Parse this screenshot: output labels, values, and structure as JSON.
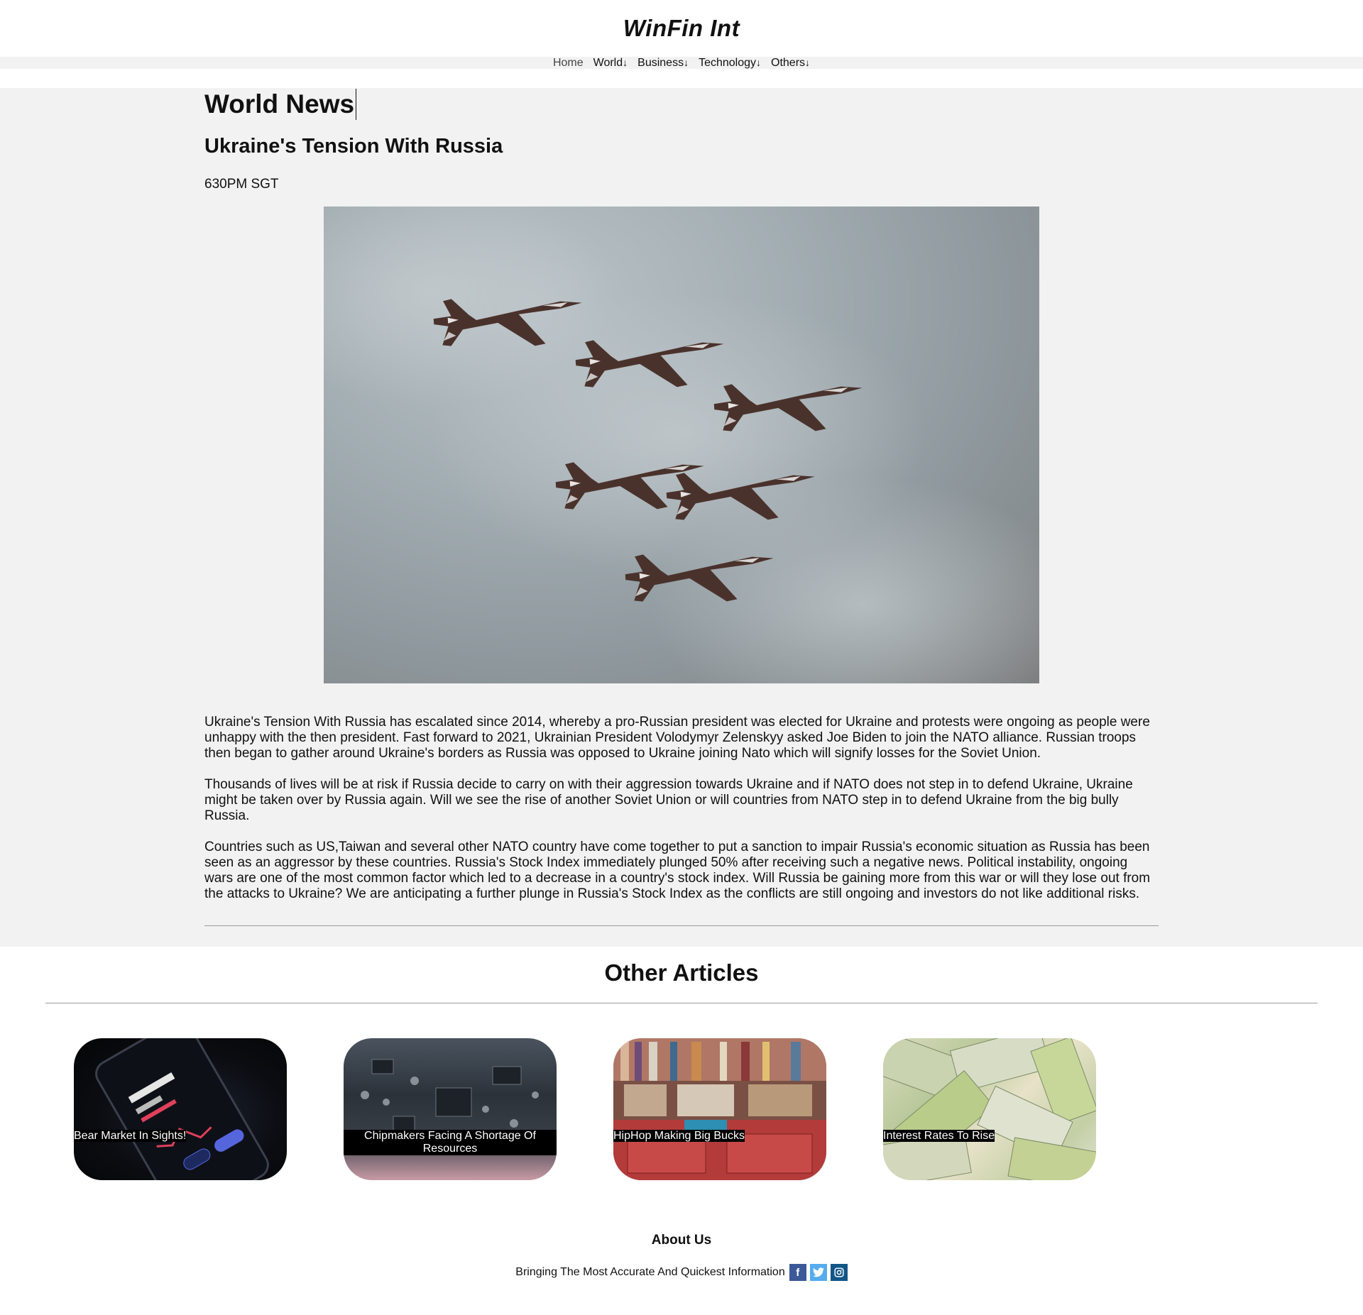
{
  "site": {
    "brand": "WinFin Int"
  },
  "nav": {
    "items": [
      {
        "label": "Home",
        "arrow": ""
      },
      {
        "label": "World",
        "arrow": "↓"
      },
      {
        "label": "Business",
        "arrow": "↓"
      },
      {
        "label": "Technology",
        "arrow": "↓"
      },
      {
        "label": "Others",
        "arrow": "↓"
      }
    ]
  },
  "main": {
    "page_title": "World News",
    "article_title": "Ukraine's Tension With Russia",
    "timestamp": "630PM SGT",
    "hero_image": "fighter-jets-formation-image",
    "paragraphs": [
      "Ukraine's Tension With Russia has escalated since 2014, whereby a pro-Russian president was elected for Ukraine and protests were ongoing as people were unhappy with the then president. Fast forward to 2021, Ukrainian President Volodymyr Zelenskyy asked Joe Biden to join the NATO alliance. Russian troops then began to gather around Ukraine's borders as Russia was opposed to Ukraine joining Nato which will signify losses for the Soviet Union.",
      "Thousands of lives will be at risk if Russia decide to carry on with their aggression towards Ukraine and if NATO does not step in to defend Ukraine, Ukraine might be taken over by Russia again. Will we see the rise of another Soviet Union or will countries from NATO step in to defend Ukraine from the big bully Russia.",
      "Countries such as US,Taiwan and several other NATO country have come together to put a sanction to impair Russia's economic situation as Russia has been seen as an aggressor by these countries. Russia's Stock Index immediately plunged 50% after receiving such a negative news. Political instability, ongoing wars are one of the most common factor which led to a decrease in a country's stock index. Will Russia be gaining more from this war or will they lose out from the attacks to Ukraine? We are anticipating a further plunge in Russia's Stock Index as the conflicts are still ongoing and investors do not like additional risks."
    ]
  },
  "other_articles": {
    "title": "Other Articles",
    "cards": [
      {
        "caption": "Bear Market In Sights!",
        "image": "stock-app-phone-image"
      },
      {
        "caption": "Chipmakers Facing A Shortage Of Resources",
        "image": "circuit-board-image"
      },
      {
        "caption": "HipHop Making Big Bucks",
        "image": "record-crates-image"
      },
      {
        "caption": "Interest Rates To Rise",
        "image": "banknotes-image"
      }
    ]
  },
  "footer": {
    "about_title": "About Us",
    "tagline": "Bringing The Most Accurate And Quickest Information",
    "social": [
      {
        "glyph": "f",
        "icon": "facebook-icon",
        "color": "#3b5998"
      },
      {
        "glyph": "t",
        "icon": "twitter-icon",
        "color": "#55acee"
      },
      {
        "glyph": "◎",
        "icon": "instagram-icon",
        "color": "#125688"
      }
    ]
  }
}
